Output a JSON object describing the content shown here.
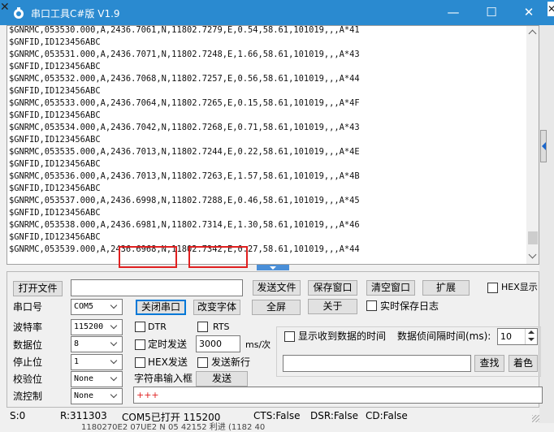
{
  "window": {
    "title": "串口工具C#版  V1.9",
    "icon": "app-icon",
    "minimize_icon": "—",
    "maximize_icon": "☐",
    "close_icon": "✕",
    "top_left_stub": "✕",
    "top_right_stub": "✕",
    "colors": {
      "titlebar": "#2a8ad0",
      "highlight_box": "#e02020",
      "send_text": "#e02020"
    }
  },
  "receive": {
    "lines": [
      "$GNRMC,053530.000,A,2436.7061,N,11802.7279,E,0.54,58.61,101019,,,A*41",
      "$GNFID,ID123456ABC",
      "$GNRMC,053531.000,A,2436.7071,N,11802.7248,E,1.66,58.61,101019,,,A*43",
      "$GNFID,ID123456ABC",
      "$GNRMC,053532.000,A,2436.7068,N,11802.7257,E,0.56,58.61,101019,,,A*44",
      "$GNFID,ID123456ABC",
      "$GNRMC,053533.000,A,2436.7064,N,11802.7265,E,0.15,58.61,101019,,,A*4F",
      "$GNFID,ID123456ABC",
      "$GNRMC,053534.000,A,2436.7042,N,11802.7268,E,0.71,58.61,101019,,,A*43",
      "$GNFID,ID123456ABC",
      "$GNRMC,053535.000,A,2436.7013,N,11802.7244,E,0.22,58.61,101019,,,A*4E",
      "$GNFID,ID123456ABC",
      "$GNRMC,053536.000,A,2436.7013,N,11802.7263,E,1.57,58.61,101019,,,A*4B",
      "$GNFID,ID123456ABC",
      "$GNRMC,053537.000,A,2436.6998,N,11802.7288,E,0.46,58.61,101019,,,A*45",
      "$GNFID,ID123456ABC",
      "$GNRMC,053538.000,A,2436.6981,N,11802.7314,E,1.30,58.61,101019,,,A*46",
      "$GNFID,ID123456ABC",
      "$GNRMC,053539.000,A,2436.6968,N,11802.7342,E,0.27,58.61,101019,,,A*44"
    ]
  },
  "toolbar": {
    "open_file": "打开文件",
    "file_path": "",
    "send_file": "发送文件",
    "save_window": "保存窗口",
    "clear_window": "清空窗口",
    "expand": "扩展",
    "hex_display": "HEX显示",
    "port_label": "串口号",
    "port_value": "COM5",
    "close_port": "关闭串口",
    "change_font": "改变字体",
    "fullscreen": "全屏",
    "about": "关于",
    "realtime_save": "实时保存日志"
  },
  "settings": {
    "baud_label": "波特率",
    "baud_value": "115200",
    "data_bits_label": "数据位",
    "data_bits_value": "8",
    "stop_bits_label": "停止位",
    "stop_bits_value": "1",
    "parity_label": "校验位",
    "parity_value": "None",
    "flow_label": "流控制",
    "flow_value": "None"
  },
  "send": {
    "dtr": "DTR",
    "rts": "RTS",
    "timed_send": "定时发送",
    "interval_value": "3000",
    "interval_unit": "ms/次",
    "hex_send": "HEX发送",
    "send_newline": "发送新行",
    "string_input_label": "字符串输入框",
    "send_button": "发送",
    "send_text": "+++"
  },
  "receive_options": {
    "show_time": "显示收到数据的时间",
    "frame_interval_label": "数据侦间隔时间(ms):",
    "frame_interval_value": "10",
    "search_value": "",
    "search_button": "查找",
    "color_button": "着色"
  },
  "status": {
    "s": "S:0",
    "r": "R:311303",
    "port_state": "COM5已打开  115200",
    "cts": "CTS:False",
    "dsr": "DSR:False",
    "cd": "CD:False"
  },
  "background_ghost": "1180270E2  07UE2 N 05 42152  利进 (1182 40"
}
